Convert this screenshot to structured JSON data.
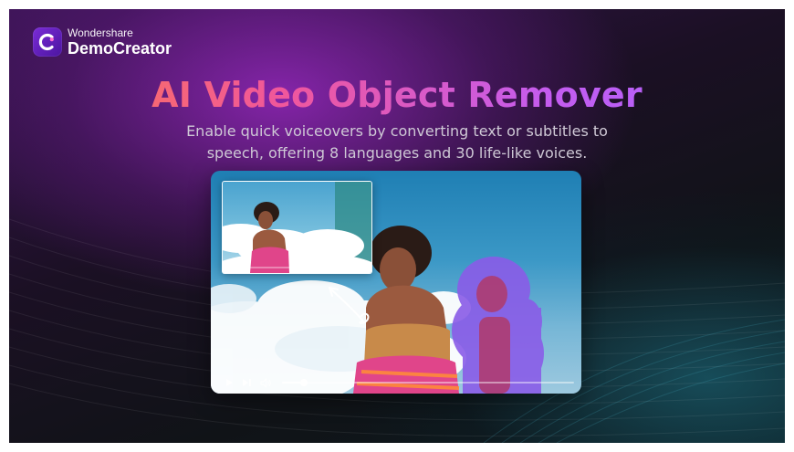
{
  "brand": {
    "company": "Wondershare",
    "product": "DemoCreator",
    "accent_color": "#7a2bd6"
  },
  "hero": {
    "title": "AI Video Object Remover",
    "subtitle_line1": "Enable quick voiceovers by converting text or subtitles to",
    "subtitle_line2": "speech, offering 8 languages and 30 life-like voices.",
    "title_gradient": [
      "#ff7a4a",
      "#f0579b",
      "#c45cf0",
      "#a765ff"
    ]
  },
  "player": {
    "controls": {
      "play_icon": "play-icon",
      "next_icon": "skip-next-icon",
      "volume_icon": "volume-icon"
    },
    "progress": 0.075
  },
  "preview": {
    "thumbnail": "original-frame-before-removal",
    "arrow_icon": "curved-arrow-icon"
  }
}
